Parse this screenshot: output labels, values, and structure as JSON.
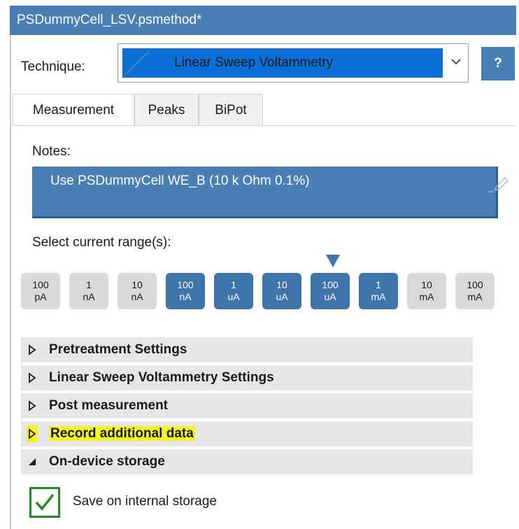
{
  "window": {
    "title": "PSDummyCell_LSV.psmethod*"
  },
  "technique": {
    "label": "Technique:",
    "value": "Linear Sweep Voltammetry",
    "help_label": "?"
  },
  "tabs": [
    {
      "label": "Measurement",
      "active": true
    },
    {
      "label": "Peaks",
      "active": false
    },
    {
      "label": "BiPot",
      "active": false
    }
  ],
  "notes": {
    "label": "Notes:",
    "value": "Use PSDummyCell WE_B (10 k Ohm 0.1%)"
  },
  "current_range": {
    "label": "Select current range(s):",
    "marker_index": 6,
    "ranges": [
      {
        "value": "100",
        "unit": "pA",
        "selected": false
      },
      {
        "value": "1",
        "unit": "nA",
        "selected": false
      },
      {
        "value": "10",
        "unit": "nA",
        "selected": false
      },
      {
        "value": "100",
        "unit": "nA",
        "selected": true
      },
      {
        "value": "1",
        "unit": "uA",
        "selected": true
      },
      {
        "value": "10",
        "unit": "uA",
        "selected": true
      },
      {
        "value": "100",
        "unit": "uA",
        "selected": true
      },
      {
        "value": "1",
        "unit": "mA",
        "selected": true
      },
      {
        "value": "10",
        "unit": "mA",
        "selected": false
      },
      {
        "value": "100",
        "unit": "mA",
        "selected": false
      }
    ]
  },
  "sections": [
    {
      "label": "Pretreatment Settings",
      "expanded": false,
      "highlighted": false
    },
    {
      "label": "Linear Sweep Voltammetry Settings",
      "expanded": false,
      "highlighted": false
    },
    {
      "label": "Post measurement",
      "expanded": false,
      "highlighted": false
    },
    {
      "label": "Record additional data",
      "expanded": false,
      "highlighted": true
    },
    {
      "label": "On-device storage",
      "expanded": true,
      "highlighted": false
    }
  ],
  "storage": {
    "label": "Save on internal storage",
    "checked": true
  },
  "colors": {
    "accent": "#4a7fb5",
    "selection": "#0a6fd6",
    "highlight": "#f3f325",
    "check": "#1e8f1e"
  }
}
